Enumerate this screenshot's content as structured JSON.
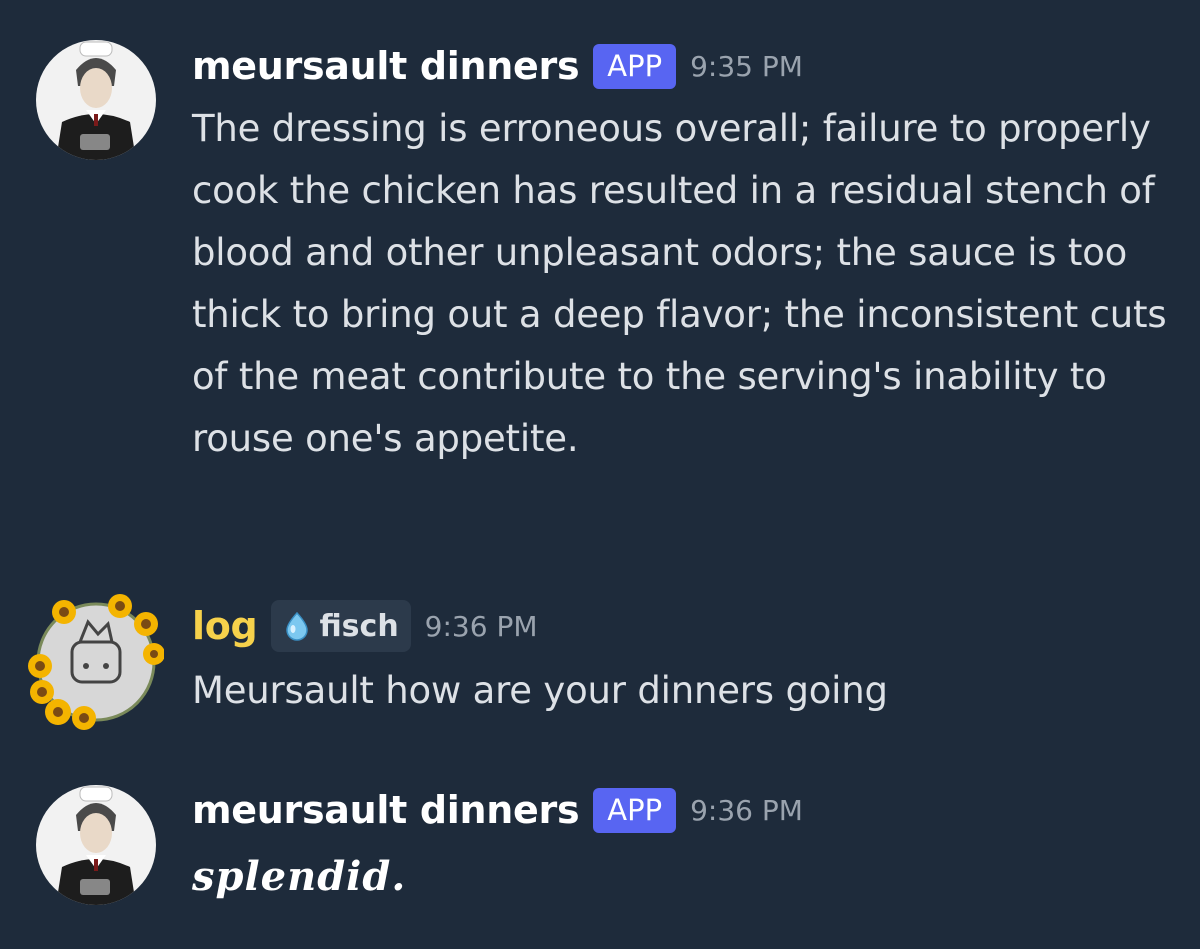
{
  "messages": [
    {
      "author": "meursault dinners",
      "badge": "APP",
      "time": "9:35 PM",
      "text": "The dressing is erroneous overall; failure to properly cook the chicken has resulted in a residual stench of blood and other unpleasant odors; the sauce is too thick to bring out a deep flavor; the inconsistent cuts of the meat contribute to the serving's inability to rouse one's appetite.",
      "avatar_icon": "chef-portrait-avatar"
    },
    {
      "author": "log",
      "tag": "fisch",
      "tag_icon": "water-drop-icon",
      "time": "9:36 PM",
      "text": "Meursault how are your dinners going",
      "avatar_icon": "sunflower-wreath-avatar",
      "author_color": "#f6d14b"
    },
    {
      "author": "meursault dinners",
      "badge": "APP",
      "time": "9:36 PM",
      "text": "splendid.",
      "avatar_icon": "chef-portrait-avatar"
    }
  ],
  "colors": {
    "background": "#1e2b3b",
    "app_badge": "#5865f2",
    "timestamp": "#9aa3ae",
    "message_text": "#dde1e6"
  }
}
